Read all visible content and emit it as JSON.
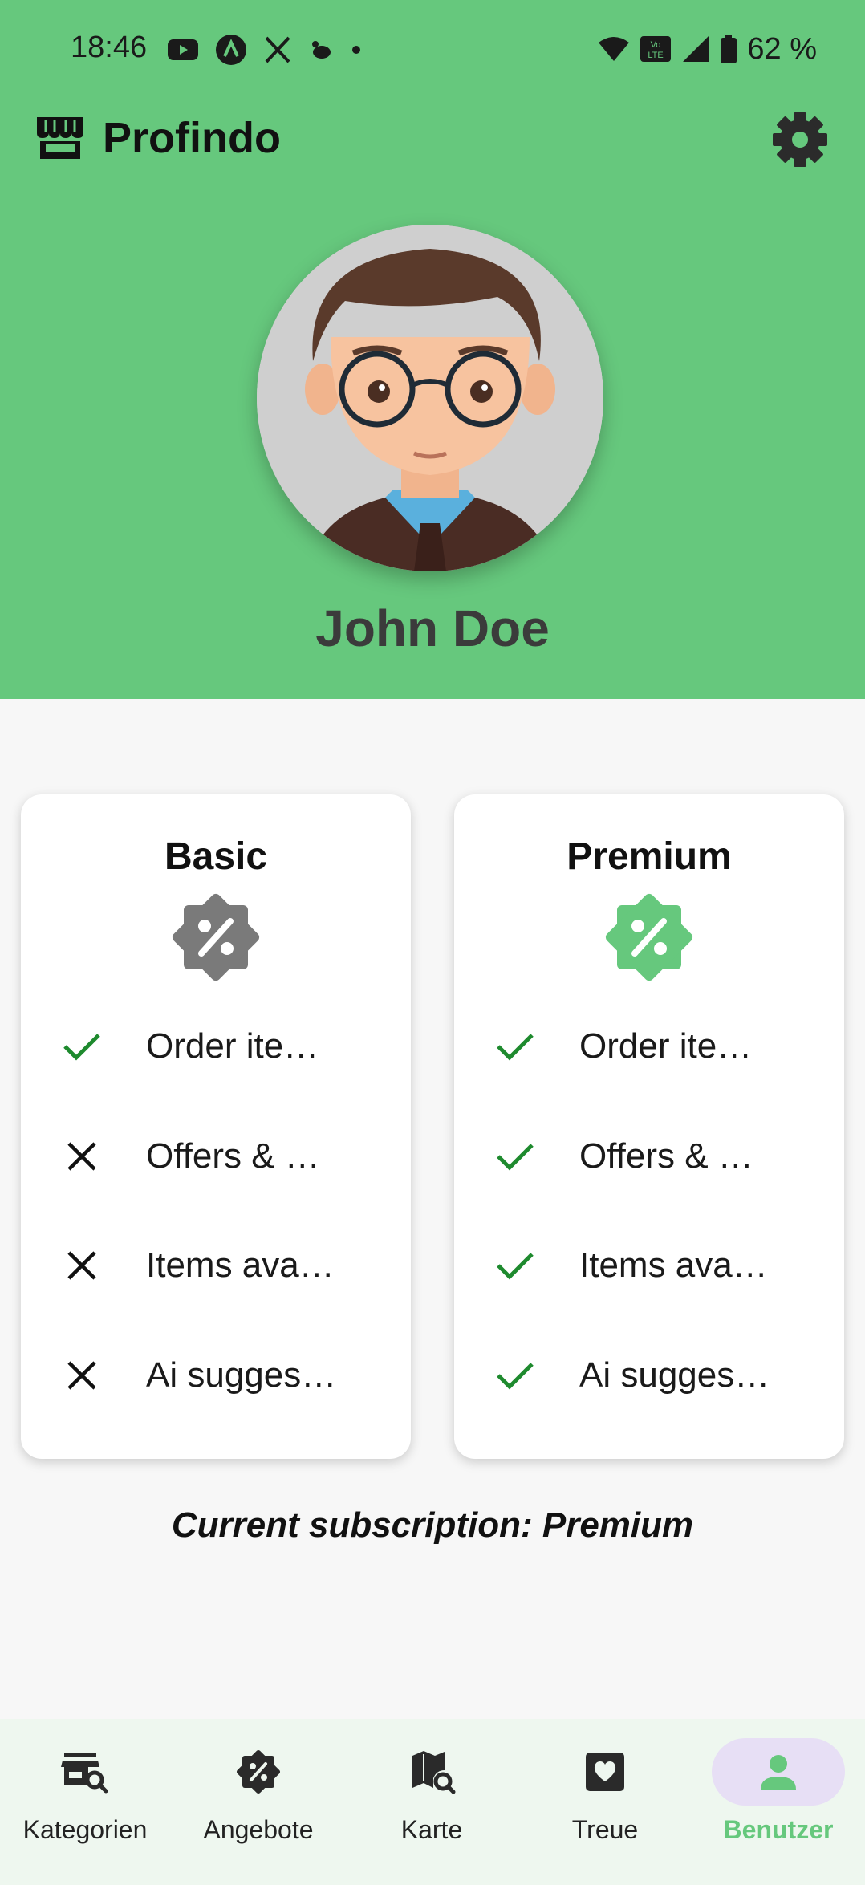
{
  "status_bar": {
    "time": "18:46",
    "battery": "62 %",
    "left_icons": [
      "youtube-icon",
      "notification-icon",
      "x-icon",
      "app-icon",
      "dot-icon"
    ],
    "right_icons": [
      "wifi-icon",
      "volte-icon",
      "signal-icon",
      "battery-icon"
    ]
  },
  "app_bar": {
    "title": "Profindo",
    "logo_icon": "store-icon",
    "settings_icon": "gear-icon"
  },
  "profile": {
    "name": "John Doe"
  },
  "plans": [
    {
      "title": "Basic",
      "badge_color": "#7a7a7a",
      "features": [
        {
          "text": "Order ite…",
          "included": true
        },
        {
          "text": "Offers & …",
          "included": false
        },
        {
          "text": "Items ava…",
          "included": false
        },
        {
          "text": "Ai sugges…",
          "included": false
        }
      ]
    },
    {
      "title": "Premium",
      "badge_color": "#66c87d",
      "features": [
        {
          "text": "Order ite…",
          "included": true
        },
        {
          "text": "Offers & …",
          "included": true
        },
        {
          "text": "Items ava…",
          "included": true
        },
        {
          "text": "Ai sugges…",
          "included": true
        }
      ]
    }
  ],
  "current_subscription": "Current subscription: Premium",
  "bottom_nav": {
    "items": [
      {
        "label": "Kategorien",
        "icon": "category-search-icon"
      },
      {
        "label": "Angebote",
        "icon": "discount-icon"
      },
      {
        "label": "Karte",
        "icon": "map-search-icon"
      },
      {
        "label": "Treue",
        "icon": "heart-icon"
      },
      {
        "label": "Benutzer",
        "icon": "person-icon",
        "active": true
      }
    ]
  },
  "colors": {
    "header": "#66c87d",
    "check": "#1e8a2e",
    "cross": "#111111",
    "active_nav_bg": "#e7dff5"
  }
}
